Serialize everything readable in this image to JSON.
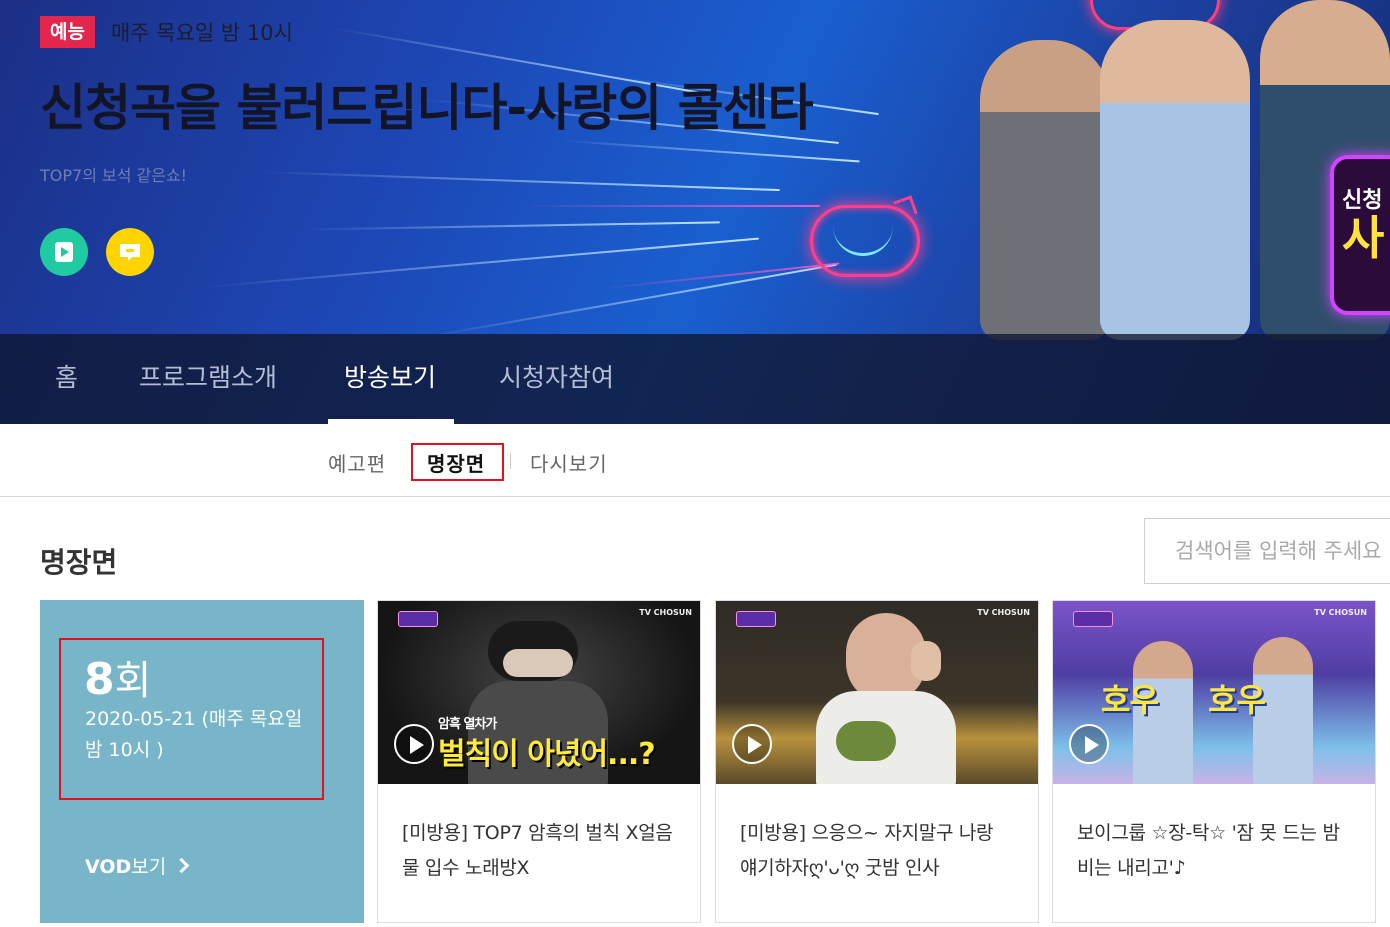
{
  "header": {
    "genre": "예능",
    "schedule": "매주 목요일 밤 10시",
    "title": "신청곡을 불러드립니다-사랑의 콜센타",
    "subtitle": "TOP7의 보석 같은쇼!",
    "sign_line1": "신청",
    "sign_line2": "사",
    "buttons": [
      {
        "icon": "play-icon",
        "color": "#20cba1"
      },
      {
        "icon": "talk-icon",
        "color": "#ffd400"
      }
    ]
  },
  "nav": {
    "items": [
      "홈",
      "프로그램소개",
      "방송보기",
      "시청자참여"
    ],
    "active": "방송보기"
  },
  "subnav": {
    "items": [
      "예고편",
      "명장면",
      "다시보기"
    ],
    "active": "명장면"
  },
  "section": {
    "title": "명장면",
    "search_placeholder": "검색어를 입력해 주세요"
  },
  "episode": {
    "number": "8",
    "unit": "회",
    "date": "2020-05-21 (매주 목요일 밤 10시 )",
    "vod_bold": "VOD",
    "vod_rest": "보기"
  },
  "clips": [
    {
      "title": "[미방용] TOP7 암흑의 벌칙 X얼음물 입수 노래방X",
      "overlay_small": "암흑 열차가",
      "overlay": "벌칙이 아녔어...?",
      "channel": "TV CHOSUN"
    },
    {
      "title": "[미방용] 으응으~ 자지말구 나랑 얘기하자ღ'ᴗ'ღ 굿밤 인사",
      "overlay_small": "",
      "overlay": "",
      "channel": "TV CHOSUN"
    },
    {
      "title": "보이그룹 ☆장-탁☆ '잠 못 드는 밤 비는 내리고'♪",
      "overlay_small": "",
      "overlay": "호우  호우",
      "channel": "TV CHOSUN"
    }
  ],
  "colors": {
    "accent_red": "#e0141e",
    "genre_badge": "#e2264c",
    "episode_card": "#78b5c8",
    "nav_bg": "#101630"
  }
}
